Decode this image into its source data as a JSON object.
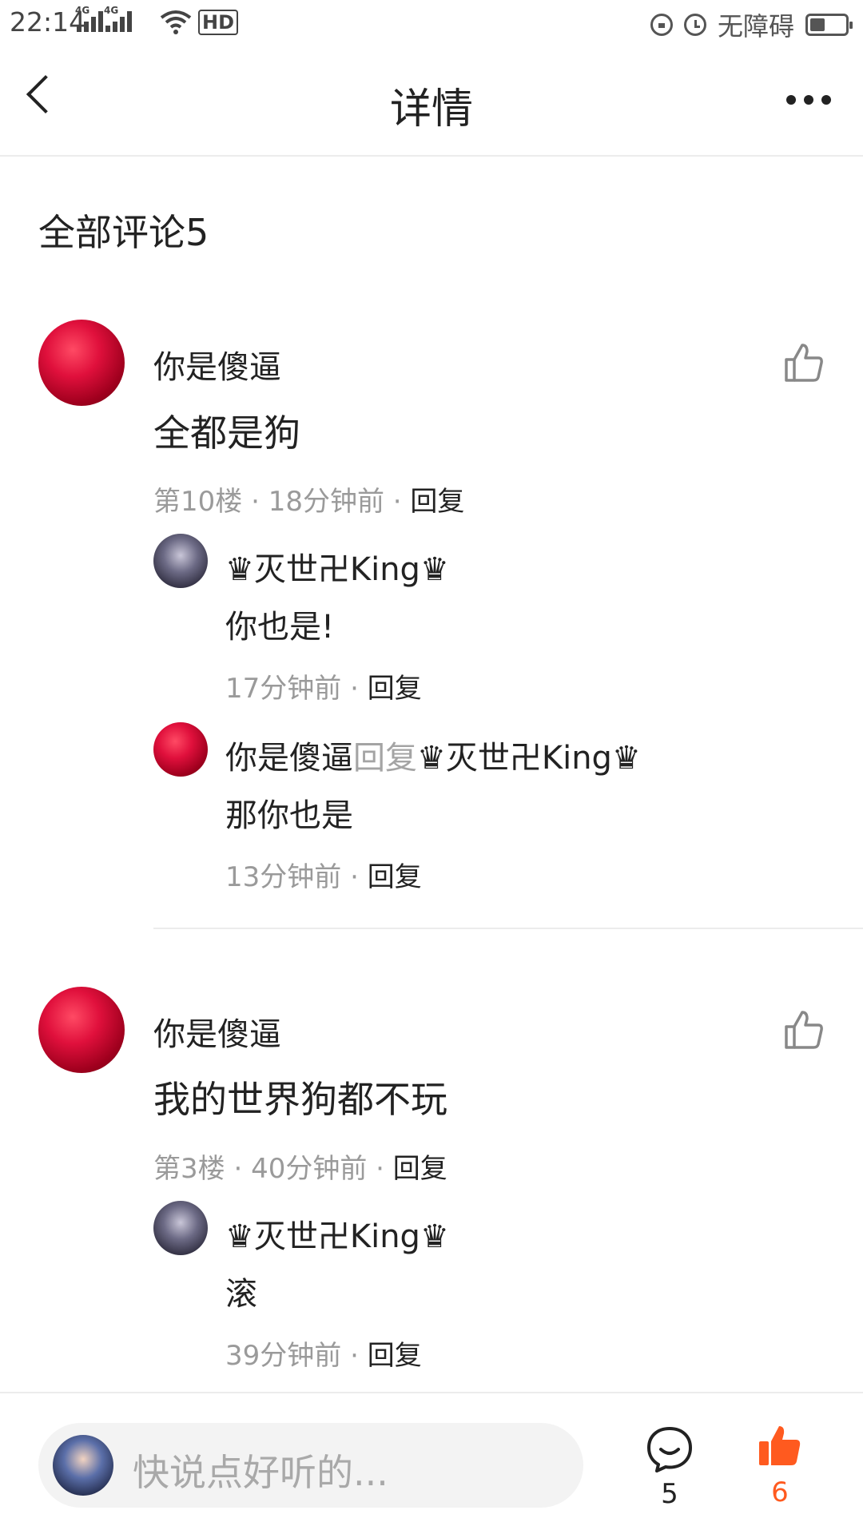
{
  "status_bar": {
    "time": "22:14",
    "network1": "4G",
    "network2": "4G",
    "hd_label": "HD",
    "accessibility_label": "无障碍"
  },
  "header": {
    "title": "详情"
  },
  "comments_section": {
    "title": "全部评论5"
  },
  "comments": [
    {
      "author": "你是傻逼",
      "text": "全都是狗",
      "floor": "第10楼",
      "time": "18分钟前",
      "reply_label": "回复",
      "replies": [
        {
          "author": "♛灭世卍King♛",
          "text": "你也是!",
          "time": "17分钟前",
          "reply_label": "回复"
        },
        {
          "author": "你是傻逼",
          "reply_word": "回复",
          "reply_to": "♛灭世卍King♛",
          "text": "那你也是",
          "time": "13分钟前",
          "reply_label": "回复"
        }
      ]
    },
    {
      "author": "你是傻逼",
      "text": "我的世界狗都不玩",
      "floor": "第3楼",
      "time": "40分钟前",
      "reply_label": "回复",
      "replies": [
        {
          "author": "♛灭世卍King♛",
          "text": "滚",
          "time": "39分钟前",
          "reply_label": "回复"
        }
      ]
    }
  ],
  "bottom_bar": {
    "input_placeholder": "快说点好听的...",
    "comment_count": "5",
    "like_count": "6"
  },
  "colors": {
    "accent": "#ff5a1f",
    "meta_gray": "#9a9a9a",
    "divider": "#ececec"
  },
  "icons": {
    "back": "chevron-left-icon",
    "more": "more-dots-icon",
    "like_outline": "thumbs-up-outline-icon",
    "comment": "comment-bubble-icon",
    "like_filled": "thumbs-up-filled-icon"
  }
}
